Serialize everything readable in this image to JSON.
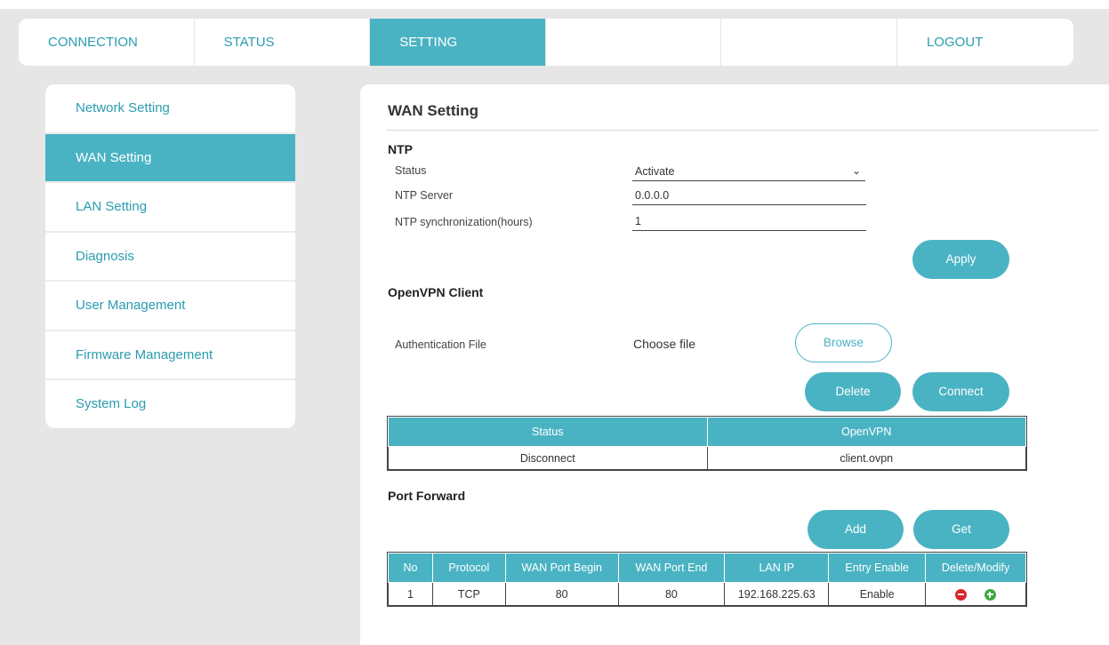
{
  "topnav": {
    "items": [
      {
        "label": "CONNECTION"
      },
      {
        "label": "STATUS"
      },
      {
        "label": "SETTING"
      },
      {
        "label": ""
      },
      {
        "label": ""
      },
      {
        "label": "LOGOUT"
      }
    ],
    "active_index": 2
  },
  "sidebar": {
    "items": [
      {
        "label": "Network Setting"
      },
      {
        "label": "WAN Setting"
      },
      {
        "label": "LAN Setting"
      },
      {
        "label": "Diagnosis"
      },
      {
        "label": "User Management"
      },
      {
        "label": "Firmware Management"
      },
      {
        "label": "System Log"
      }
    ],
    "active_index": 1
  },
  "main": {
    "title": "WAN Setting",
    "ntp": {
      "title": "NTP",
      "status_label": "Status",
      "status_value": "Activate",
      "server_label": "NTP Server",
      "server_value": "0.0.0.0",
      "sync_label": "NTP synchronization(hours)",
      "sync_value": "1",
      "apply_label": "Apply"
    },
    "openvpn": {
      "title": "OpenVPN Client",
      "auth_label": "Authentication File",
      "choose_file": "Choose file",
      "browse_label": "Browse",
      "delete_label": "Delete",
      "connect_label": "Connect",
      "table": {
        "headers": [
          "Status",
          "OpenVPN"
        ],
        "row": [
          "Disconnect",
          "client.ovpn"
        ]
      }
    },
    "port_forward": {
      "title": "Port Forward",
      "add_label": "Add",
      "get_label": "Get",
      "table": {
        "headers": [
          "No",
          "Protocol",
          "WAN Port Begin",
          "WAN Port End",
          "LAN IP",
          "Entry Enable",
          "Delete/Modify"
        ],
        "row": [
          "1",
          "TCP",
          "80",
          "80",
          "192.168.225.63",
          "Enable"
        ]
      }
    }
  },
  "colors": {
    "accent": "#4ab3c3",
    "link": "#2a9cb0",
    "background": "#e6e6e6",
    "delete_icon": "#d9262c",
    "add_icon": "#3fa83f"
  }
}
